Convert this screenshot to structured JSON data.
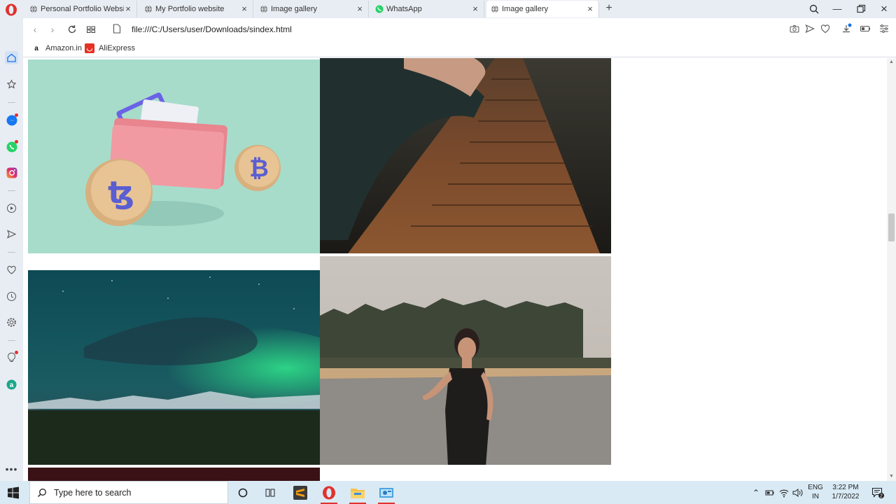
{
  "browser": {
    "tabs": [
      {
        "title": "Personal Portfolio Website",
        "active": false
      },
      {
        "title": "My Portfolio website",
        "active": false
      },
      {
        "title": "Image gallery",
        "active": false
      },
      {
        "title": "WhatsApp",
        "active": false
      },
      {
        "title": "Image gallery",
        "active": true
      }
    ],
    "url": "file:///C:/Users/user/Downloads/sindex.html",
    "bookmarks": [
      {
        "label": "Amazon.in",
        "icon": "amazon-icon"
      },
      {
        "label": "AliExpress",
        "icon": "aliexpress-icon"
      }
    ],
    "sidebar_icons": [
      "home-icon",
      "star-icon",
      "messenger-icon",
      "whatsapp-icon",
      "instagram-icon",
      "player-icon",
      "send-icon",
      "heart-icon",
      "history-icon",
      "settings-icon",
      "bulb-icon",
      "aria-icon",
      "more-icon"
    ]
  },
  "gallery": {
    "images": [
      {
        "subject": "crypto wallet with coins",
        "icon": "crypto-wallet-image"
      },
      {
        "subject": "wooden boardwalk with arm",
        "icon": "boardwalk-image"
      },
      {
        "subject": "aurora over mountains",
        "icon": "aurora-image"
      },
      {
        "subject": "woman in black dress on road",
        "icon": "portrait-image"
      }
    ]
  },
  "taskbar": {
    "search_placeholder": "Type here to search",
    "language_top": "ENG",
    "language_bottom": "IN",
    "time": "3:22 PM",
    "date": "1/7/2022",
    "notification_count": "2"
  }
}
